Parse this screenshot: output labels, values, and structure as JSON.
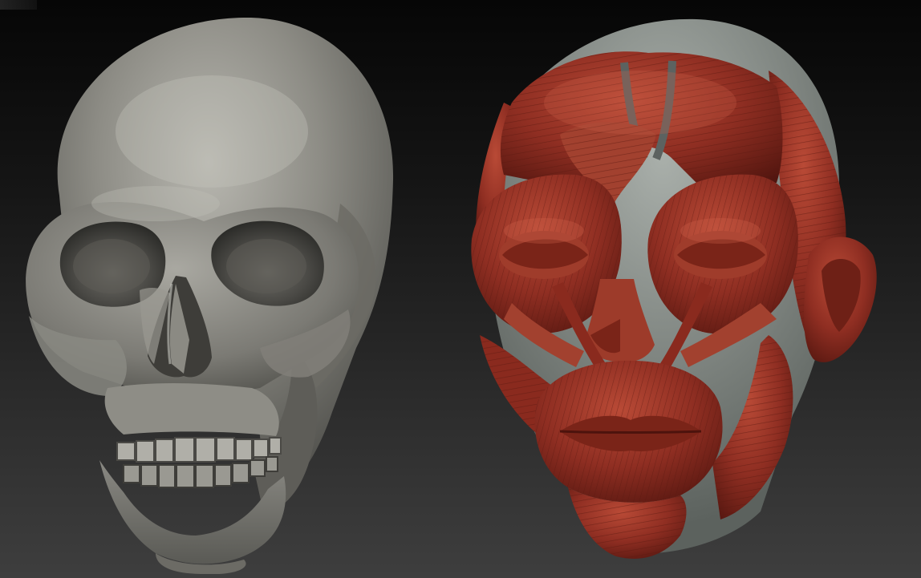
{
  "viewport": {
    "background_top": "#060606",
    "background_bottom": "#3e3e3e"
  },
  "models": [
    {
      "name": "skull",
      "color": "#7e7e77",
      "highlight": "#b2b1aa",
      "shadow": "#3f3f3b"
    },
    {
      "name": "ecorche-head",
      "color": "#8f2e22",
      "highlight": "#c0543f",
      "shadow": "#4d130d",
      "underlay": "#7b807c"
    }
  ]
}
